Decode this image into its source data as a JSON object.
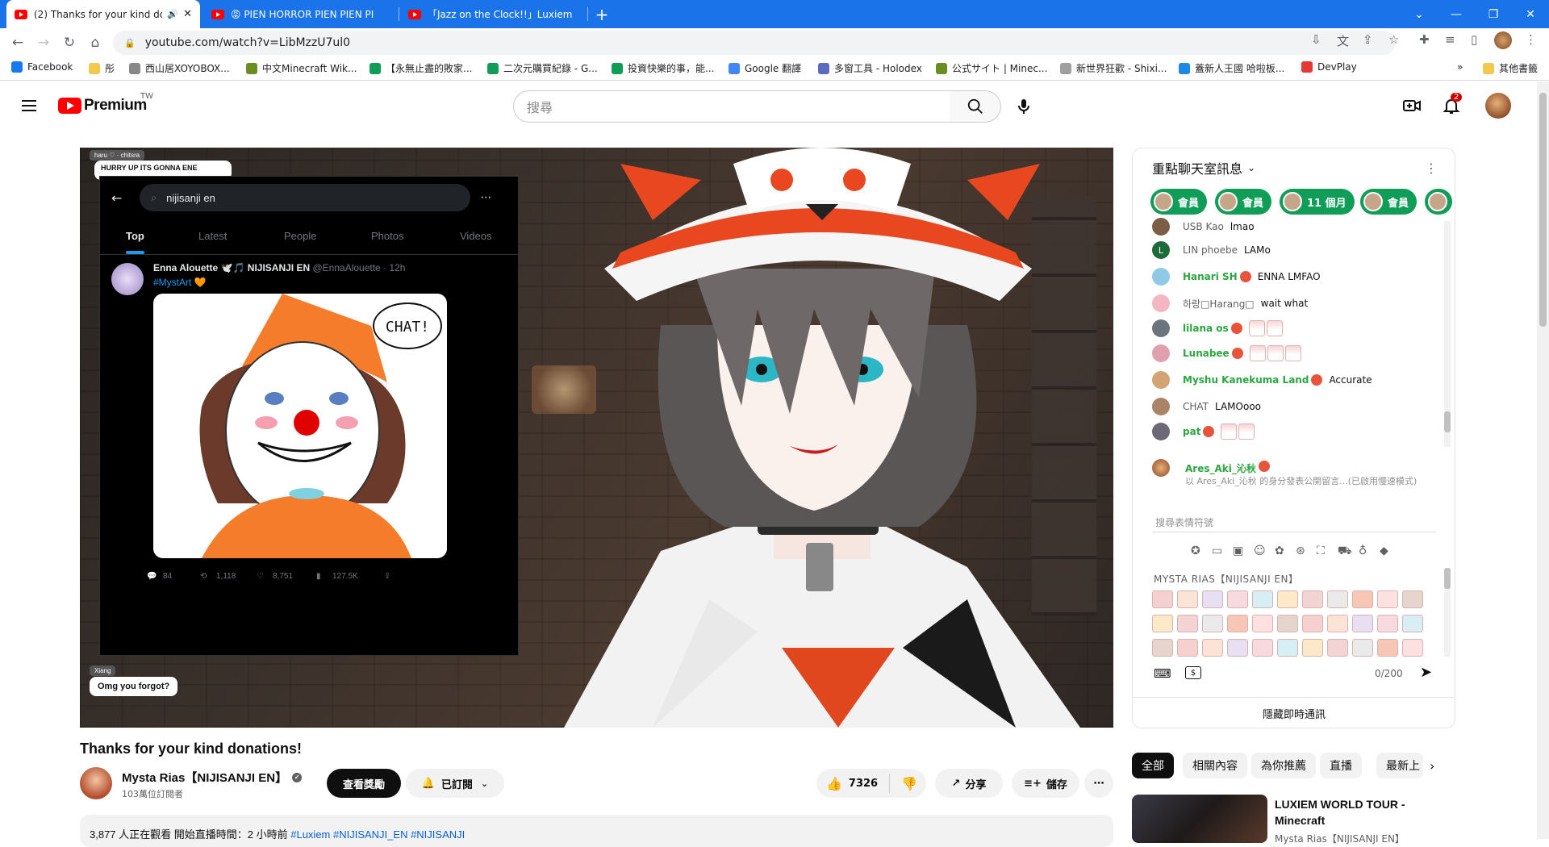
{
  "browser": {
    "tabs": [
      {
        "title": "(2) Thanks for your kind do",
        "active": true
      },
      {
        "title": "😡 PIEN HORROR PIEN PIEN PI",
        "active": false
      },
      {
        "title": "「Jazz on the Clock!!」Luxiem",
        "active": false
      }
    ],
    "new_tab": "+",
    "url": "youtube.com/watch?v=LibMzzU7ul0",
    "window_controls": [
      "⌄",
      "—",
      "❐",
      "✕"
    ]
  },
  "bookmarks": [
    {
      "label": "Facebook",
      "color": "#1877f2"
    },
    {
      "label": "彤",
      "color": "#f2c94c"
    },
    {
      "label": "西山居XOYOBOX...",
      "color": "#888888"
    },
    {
      "label": "中文Minecraft Wik...",
      "color": "#6b8e23"
    },
    {
      "label": "【永無止盡的敗家...",
      "color": "#0f9d58"
    },
    {
      "label": "二次元購買紀錄 - G...",
      "color": "#0f9d58"
    },
    {
      "label": "投資快樂的事，能...",
      "color": "#0f9d58"
    },
    {
      "label": "Google 翻譯",
      "color": "#4285f4"
    },
    {
      "label": "多窗工具 - Holodex",
      "color": "#5c6bc0"
    },
    {
      "label": "公式サイト | Minec...",
      "color": "#6b8e23"
    },
    {
      "label": "新世界狂歡 - Shixi...",
      "color": "#9e9e9e"
    },
    {
      "label": "蓋新人王國 哈啦板...",
      "color": "#1e88e5"
    },
    {
      "label": "DevPlay",
      "color": "#e53935"
    }
  ],
  "bookmarks_more": "»",
  "bookmarks_other": "其他書籤",
  "youtube": {
    "logo_text": "Premium",
    "country_code": "TW",
    "search_placeholder": "搜尋",
    "notification_count": "2"
  },
  "player": {
    "tweet": {
      "search_query": "nijisanji en",
      "tabs": [
        "Top",
        "Latest",
        "People",
        "Photos",
        "Videos"
      ],
      "author": "Enna Alouette 🕊️🎵 NIJISANJI EN",
      "handle": "@EnnaAlouette · 12h",
      "hashtag": "#MystArt 🧡",
      "drawing_text": "CHAT!",
      "stats": [
        "84",
        "1,118",
        "8,751",
        "127.5K"
      ]
    },
    "overlay_top_tag": "haru ♡ · chitsra",
    "overlay_top_note": "HURRY UP ITS GONNA ENE",
    "overlay_bottom_tag": "Xiang",
    "overlay_bottom_note": "Omg you forgot?"
  },
  "video": {
    "title": "Thanks for your kind donations!",
    "channel": "Mysta Rias【NIJISANJI EN】",
    "subscribers": "103萬位訂閱者",
    "perks_button": "查看獎勵",
    "subscribed_button": "已訂閱",
    "likes": "7326",
    "share": "分享",
    "save": "儲存",
    "more": "⋯",
    "description_meta": "3,877 人正在觀看  開始直播時間：2 小時前",
    "description_tags": "#Luxiem #NIJISANJI_EN #NIJISANJI"
  },
  "chat": {
    "header": "重點聊天室訊息",
    "badges": [
      "會員",
      "會員",
      "11 個月",
      "會員"
    ],
    "messages": [
      {
        "author": "USB Kao",
        "text": "lmao",
        "member": false,
        "color": "#7b5e45"
      },
      {
        "author": "LIN phoebe",
        "text": "LAMo",
        "member": false,
        "color": "#1e6b3a",
        "initial": "L"
      },
      {
        "author": "Hanari SH",
        "text": "ENNA LMFAO",
        "member": true,
        "color": "#8ecae6"
      },
      {
        "author": "하랑□Harang□",
        "text": "wait what",
        "member": false,
        "color": "#f4b6c2"
      },
      {
        "author": "lilana os",
        "text": "",
        "member": true,
        "color": "#6c757d"
      },
      {
        "author": "Lunabee",
        "text": "",
        "member": true,
        "color": "#e0a0b0"
      },
      {
        "author": "Myshu Kanekuma Land",
        "text": "Accurate",
        "member": true,
        "color": "#d4a373"
      },
      {
        "author": "CHAT",
        "text": "LAMOooo",
        "member": false,
        "color": "#a98467"
      },
      {
        "author": "pat",
        "text": "",
        "member": true,
        "color": "#6d6875"
      }
    ],
    "composer_author": "Ares_Aki_沁秋",
    "composer_note": "以 Ares_Aki_沁秋 的身分發表公開留言...(已啟用慢速模式)",
    "input_placeholder": "搜尋表情符號",
    "emoji_section_title": "MYSTA RIAS【NIJISANJI EN】",
    "char_count": "0/200",
    "hide_chat": "隱藏即時通訊"
  },
  "chips": [
    "全部",
    "相關內容",
    "為你推薦",
    "直播",
    "最新上"
  ],
  "recommendation": {
    "title": "LUXIEM WORLD TOUR - Minecraft",
    "channel": "Mysta Rias【NIJISANJI EN】"
  }
}
